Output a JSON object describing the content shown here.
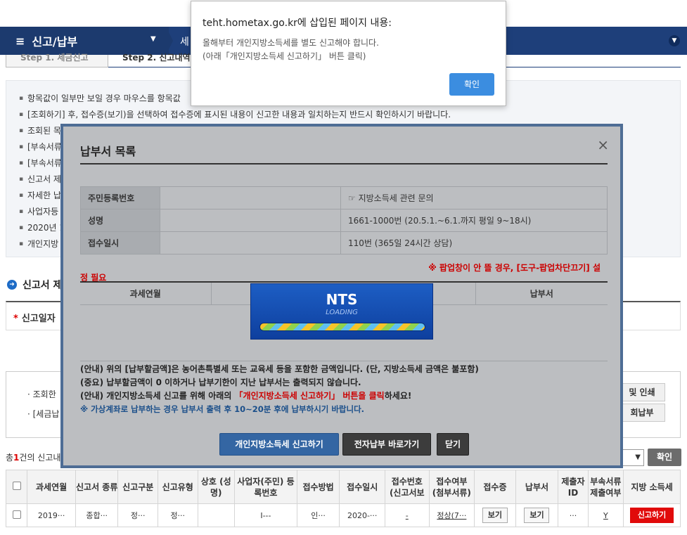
{
  "nav": {
    "menu_label": "신고/납부",
    "sub_label": "세",
    "steps": [
      "Step 1. 세금신고",
      "Step 2. 신고내역"
    ]
  },
  "notice": [
    "항목값이 일부만 보일 경우 마우스를 항목값",
    "[조회하기] 후, 접수증(보기)을 선택하여 접수증에 표시된 내용이 신고한 내용과 일치하는지 반드시 확인하시기 바랍니다.",
    "조회된 목",
    "[부속서류",
    "[부속서류",
    "신고서 제",
    "사업자등",
    "2020년 1"
  ],
  "notice_cont": [
    "자세한 납",
    "개인지방"
  ],
  "section_title": "신고서 제",
  "required_label": "신고일자",
  "inquiry": {
    "line1": "· 조회한",
    "line2": "· [세금납",
    "print_button": "및 인쇄",
    "pay_button": "회납부"
  },
  "count": {
    "prefix": "총",
    "num": "1",
    "suffix": "건의 신고내"
  },
  "confirm_label": "확인",
  "table": {
    "headers": [
      "",
      "과세연월",
      "신고서 종류",
      "신고구분",
      "신고유형",
      "상호 (성명)",
      "사업자(주민) 등록번호",
      "접수방법",
      "접수일시",
      "접수번호 (신고서보",
      "접수여부 (첨부서류)",
      "접수증",
      "납부서",
      "제출자 ID",
      "부속서류 제출여부",
      "지방 소득세"
    ],
    "row": [
      "",
      "2019···",
      "종합···",
      "정···",
      "정···",
      "",
      "I---",
      "인···",
      "2020-···",
      "-",
      "정상(7···",
      "보기",
      "보기",
      "···",
      "Y",
      "신고하기"
    ]
  },
  "modal": {
    "title": "납부서 목록",
    "close": "×",
    "info": [
      {
        "label": "주민등록번호",
        "value": "",
        "info": "☞ 지방소득세 관련 문의"
      },
      {
        "label": "성명",
        "value": "",
        "info": "1661-1000번 (20.5.1.~6.1.까지 평일 9~18시)"
      },
      {
        "label": "접수일시",
        "value": "",
        "info": "110번 (365일 24시간 상담)"
      }
    ],
    "popup_warn": "※ 팝업창이 안 뜰 경우, [도구-팝업차단끄기] 설",
    "popup_warn2": "정 필요",
    "list_headers": [
      "과세연월",
      "",
      "",
      "납부서"
    ],
    "guide1": "(안내) 위의 [납부할금액]은 농어촌특별세 또는 교육세 등을 포함한 금액입니다. (단, 지방소득세 금액은 불포함)",
    "guide2": "(중요) 납부할금액이 0 이하거나 납부기한이 지난 납부서는 출력되지 않습니다.",
    "guide3a": "(안내) 개인지방소득세 신고를 위해  아래의 ",
    "guide3b": "「개인지방소득세 신고하기」 버튼을 클릭",
    "guide3c": "하세요!",
    "guide4": "※ 가상계좌로 납부하는 경우 납부서 출력 후 10~20분 후에 납부하시기 바랍니다.",
    "btn_local": "개인지방소득세 신고하기",
    "btn_epay": "전자납부 바로가기",
    "btn_close": "닫기"
  },
  "loading": {
    "logo": "NTS",
    "text": "LOADING"
  },
  "alert": {
    "head": "teht.hometax.go.kr에 삽입된 페이지 내용:",
    "msg1": "올해부터 개인지방소득세를 별도 신고해야 합니다.",
    "msg2": "(아래「개인지방소득세 신고하기」 버튼 클릭)",
    "ok": "확인"
  }
}
